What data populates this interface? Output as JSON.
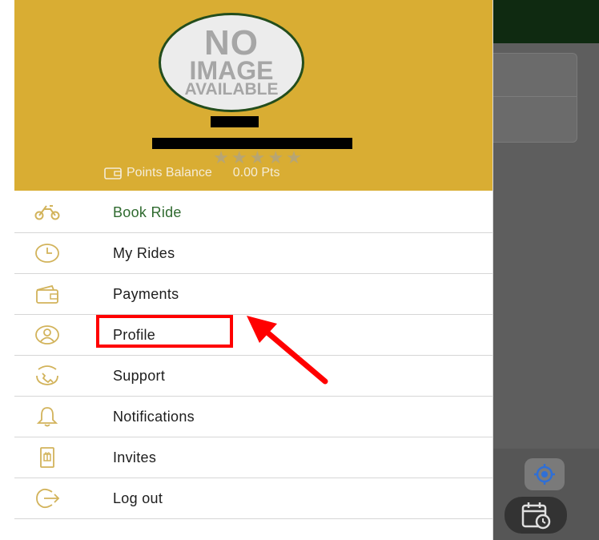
{
  "profile": {
    "avatar_lines": [
      "NO",
      "IMAGE",
      "AVAILABLE"
    ],
    "rating_stars": "★★★★★",
    "points_label": "Points Balance",
    "points_value": "0.00 Pts"
  },
  "menu": {
    "items": [
      {
        "label": "Book Ride",
        "icon": "bike-icon",
        "active": true
      },
      {
        "label": "My Rides",
        "icon": "clock-icon"
      },
      {
        "label": "Payments",
        "icon": "wallet-icon"
      },
      {
        "label": "Profile",
        "icon": "user-icon"
      },
      {
        "label": "Support",
        "icon": "phone-icon"
      },
      {
        "label": "Notifications",
        "icon": "bell-icon"
      },
      {
        "label": "Invites",
        "icon": "gift-icon"
      },
      {
        "label": "Log out",
        "icon": "logout-icon"
      }
    ]
  },
  "colors": {
    "header": "#d9ad33",
    "active_text": "#2f6a2f",
    "icon": "#d2b35b",
    "annotation": "#ff0000"
  }
}
